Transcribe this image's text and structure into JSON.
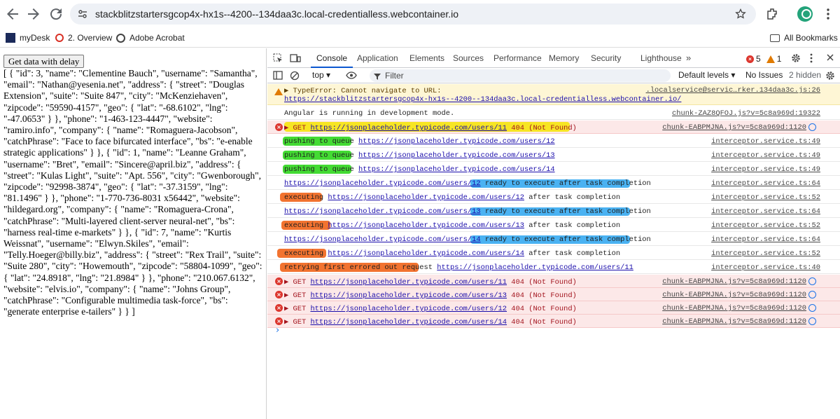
{
  "browser": {
    "url": "stackblitzstartersgcop4x-hx1s--4200--134daa3c.local-credentialless.webcontainer.io",
    "bookmarks": [
      "myDesk",
      "2. Overview",
      "Adobe Acrobat"
    ],
    "all_bookmarks": "All Bookmarks"
  },
  "page": {
    "button_label": "Get data with delay",
    "output": "[ { \"id\": 3, \"name\": \"Clementine Bauch\", \"username\": \"Samantha\", \"email\": \"Nathan@yesenia.net\", \"address\": { \"street\": \"Douglas Extension\", \"suite\": \"Suite 847\", \"city\": \"McKenziehaven\", \"zipcode\": \"59590-4157\", \"geo\": { \"lat\": \"-68.6102\", \"lng\": \"-47.0653\" } }, \"phone\": \"1-463-123-4447\", \"website\": \"ramiro.info\", \"company\": { \"name\": \"Romaguera-Jacobson\", \"catchPhrase\": \"Face to face bifurcated interface\", \"bs\": \"e-enable strategic applications\" } }, { \"id\": 1, \"name\": \"Leanne Graham\", \"username\": \"Bret\", \"email\": \"Sincere@april.biz\", \"address\": { \"street\": \"Kulas Light\", \"suite\": \"Apt. 556\", \"city\": \"Gwenborough\", \"zipcode\": \"92998-3874\", \"geo\": { \"lat\": \"-37.3159\", \"lng\": \"81.1496\" } }, \"phone\": \"1-770-736-8031 x56442\", \"website\": \"hildegard.org\", \"company\": { \"name\": \"Romaguera-Crona\", \"catchPhrase\": \"Multi-layered client-server neural-net\", \"bs\": \"harness real-time e-markets\" } }, { \"id\": 7, \"name\": \"Kurtis Weissnat\", \"username\": \"Elwyn.Skiles\", \"email\": \"Telly.Hoeger@billy.biz\", \"address\": { \"street\": \"Rex Trail\", \"suite\": \"Suite 280\", \"city\": \"Howemouth\", \"zipcode\": \"58804-1099\", \"geo\": { \"lat\": \"24.8918\", \"lng\": \"21.8984\" } }, \"phone\": \"210.067.6132\", \"website\": \"elvis.io\", \"company\": { \"name\": \"Johns Group\", \"catchPhrase\": \"Configurable multimedia task-force\", \"bs\": \"generate enterprise e-tailers\" } } ]"
  },
  "devtools": {
    "tabs": [
      "Console",
      "Application",
      "Elements",
      "Sources",
      "Performance",
      "Memory",
      "Security",
      "Lighthouse"
    ],
    "error_count": "5",
    "warning_count": "1",
    "context": "top",
    "filter_placeholder": "Filter",
    "levels": "Default levels",
    "issues": "No Issues",
    "hidden": "2 hidden",
    "colors": {
      "error_bg": "#fce8e8",
      "warn_bg": "#fef6d5",
      "accent": "#0b57d0"
    },
    "rows": [
      {
        "type": "warn",
        "text": "▶ TypeError: Cannot navigate to URL:",
        "link": "https://stackblitzstartersgcop4x-hx1s--4200--134daa3c.local-credentialless.webcontainer.io/",
        "src": ".localservice@servic…rker.134daa3c.js:26"
      },
      {
        "type": "log",
        "text": "Angular is running in development mode.",
        "src": "chunk-ZAZ8QFOJ.js?v=5c8a969d:19322"
      },
      {
        "type": "error",
        "prefix": "▶ GET ",
        "link": "https://jsonplaceholder.typicode.com/users/11",
        "suffix": " 404 (Not Found)",
        "src": "chunk-EABPMJNA.js?v=5c8a969d:1120"
      },
      {
        "type": "log",
        "text": "pushing to queue ",
        "link": "https://jsonplaceholder.typicode.com/users/12",
        "src": "interceptor.service.ts:49"
      },
      {
        "type": "log",
        "text": "pushing to queue ",
        "link": "https://jsonplaceholder.typicode.com/users/13",
        "src": "interceptor.service.ts:49"
      },
      {
        "type": "log",
        "text": "pushing to queue ",
        "link": "https://jsonplaceholder.typicode.com/users/14",
        "src": "interceptor.service.ts:49"
      },
      {
        "type": "log",
        "link": "https://jsonplaceholder.typicode.com/users/12",
        "suffix": " ready to execute after task completion",
        "src": "interceptor.service.ts:64"
      },
      {
        "type": "log",
        "text": "executing ",
        "link": "https://jsonplaceholder.typicode.com/users/12",
        "suffix": " after  task completion",
        "src": "interceptor.service.ts:52"
      },
      {
        "type": "log",
        "link": "https://jsonplaceholder.typicode.com/users/13",
        "suffix": " ready to execute after task completion",
        "src": "interceptor.service.ts:64"
      },
      {
        "type": "log",
        "text": "executing ",
        "link": "https://jsonplaceholder.typicode.com/users/13",
        "suffix": " after  task completion",
        "src": "interceptor.service.ts:52"
      },
      {
        "type": "log",
        "link": "https://jsonplaceholder.typicode.com/users/14",
        "suffix": " ready to execute after task completion",
        "src": "interceptor.service.ts:64"
      },
      {
        "type": "log",
        "text": "executing ",
        "link": "https://jsonplaceholder.typicode.com/users/14",
        "suffix": " after  task completion",
        "src": "interceptor.service.ts:52"
      },
      {
        "type": "log",
        "text": "retrying first errored out request ",
        "link": "https://jsonplaceholder.typicode.com/users/11",
        "src": "interceptor.service.ts:40"
      },
      {
        "type": "error",
        "prefix": "▶ GET ",
        "link": "https://jsonplaceholder.typicode.com/users/11",
        "suffix": " 404 (Not Found)",
        "src": "chunk-EABPMJNA.js?v=5c8a969d:1120"
      },
      {
        "type": "error",
        "prefix": "▶ GET ",
        "link": "https://jsonplaceholder.typicode.com/users/13",
        "suffix": " 404 (Not Found)",
        "src": "chunk-EABPMJNA.js?v=5c8a969d:1120"
      },
      {
        "type": "error",
        "prefix": "▶ GET ",
        "link": "https://jsonplaceholder.typicode.com/users/12",
        "suffix": " 404 (Not Found)",
        "src": "chunk-EABPMJNA.js?v=5c8a969d:1120"
      },
      {
        "type": "error",
        "prefix": "▶ GET ",
        "link": "https://jsonplaceholder.typicode.com/users/14",
        "suffix": " 404 (Not Found)",
        "src": "chunk-EABPMJNA.js?v=5c8a969d:1120"
      }
    ],
    "prompt": "›"
  }
}
